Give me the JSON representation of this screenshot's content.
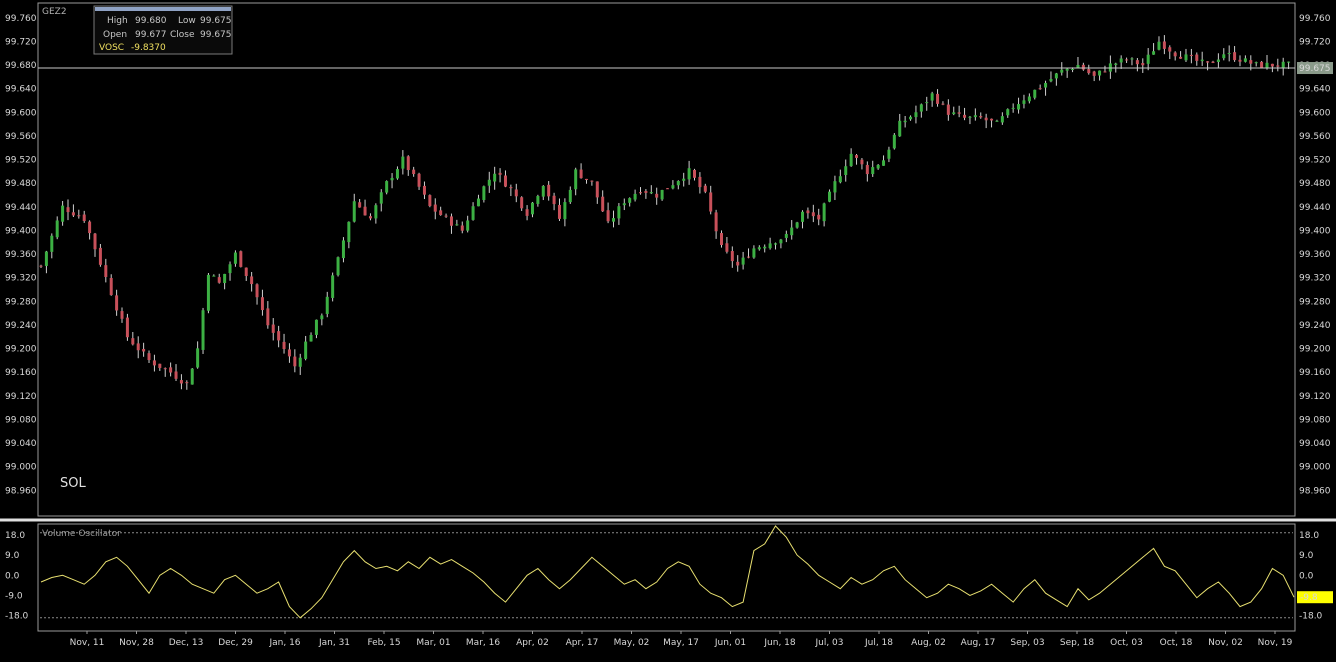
{
  "symbol": "GEZ2",
  "panel_label": "SOL",
  "infobox": {
    "high_label": "High",
    "high_value": "99.680",
    "low_label": "Low",
    "low_value": "99.675",
    "open_label": "Open",
    "open_value": "99.677",
    "close_label": "Close",
    "close_value": "99.675",
    "vosc_label": "VOSC",
    "vosc_value": "-9.8370"
  },
  "colors": {
    "background": "#000000",
    "up_candle": "#3cb043",
    "down_candle": "#c8505a",
    "wick": "#d0d0d0",
    "oscillator_line": "#e8e070",
    "price_marker": "#8a9a8a",
    "osc_marker": "#ffff00",
    "frame": "#9a9a9a",
    "splitter": "#e0e0e0"
  },
  "chart_data": [
    {
      "type": "candlestick",
      "title": "GEZ2",
      "ylim": [
        98.92,
        99.78
      ],
      "y_ticks": [
        "99.760",
        "99.720",
        "99.680",
        "99.640",
        "99.600",
        "99.560",
        "99.520",
        "99.480",
        "99.440",
        "99.400",
        "99.360",
        "99.320",
        "99.280",
        "99.240",
        "99.200",
        "99.160",
        "99.120",
        "99.080",
        "99.040",
        "99.000",
        "98.960"
      ],
      "last_price": 99.675,
      "last_price_label": "99.675",
      "x_date_labels": [
        "Nov, 11",
        "Nov, 28",
        "Dec, 13",
        "Dec, 29",
        "Jan, 16",
        "Jan, 31",
        "Feb, 15",
        "Mar, 01",
        "Mar, 16",
        "Apr, 02",
        "Apr, 17",
        "May, 02",
        "May, 17",
        "Jun, 01",
        "Jun, 18",
        "Jul, 03",
        "Jul, 18",
        "Aug, 02",
        "Aug, 17",
        "Sep, 03",
        "Sep, 18",
        "Oct, 03",
        "Oct, 18",
        "Nov, 02",
        "Nov, 19"
      ],
      "close_path": [
        [
          0,
          99.34
        ],
        [
          4,
          99.44
        ],
        [
          8,
          99.42
        ],
        [
          12,
          99.32
        ],
        [
          16,
          99.22
        ],
        [
          20,
          99.18
        ],
        [
          24,
          99.16
        ],
        [
          27,
          99.14
        ],
        [
          29,
          99.2
        ],
        [
          31,
          99.33
        ],
        [
          33,
          99.31
        ],
        [
          36,
          99.36
        ],
        [
          39,
          99.31
        ],
        [
          42,
          99.24
        ],
        [
          45,
          99.2
        ],
        [
          47,
          99.17
        ],
        [
          49,
          99.21
        ],
        [
          52,
          99.26
        ],
        [
          55,
          99.35
        ],
        [
          58,
          99.45
        ],
        [
          61,
          99.42
        ],
        [
          64,
          99.48
        ],
        [
          67,
          99.52
        ],
        [
          69,
          99.49
        ],
        [
          72,
          99.44
        ],
        [
          75,
          99.42
        ],
        [
          78,
          99.4
        ],
        [
          81,
          99.46
        ],
        [
          84,
          99.5
        ],
        [
          87,
          99.47
        ],
        [
          90,
          99.43
        ],
        [
          93,
          99.48
        ],
        [
          96,
          99.42
        ],
        [
          99,
          99.5
        ],
        [
          102,
          99.48
        ],
        [
          105,
          99.41
        ],
        [
          108,
          99.45
        ],
        [
          111,
          99.47
        ],
        [
          114,
          99.46
        ],
        [
          117,
          99.48
        ],
        [
          120,
          99.5
        ],
        [
          123,
          99.46
        ],
        [
          126,
          99.37
        ],
        [
          129,
          99.34
        ],
        [
          132,
          99.37
        ],
        [
          135,
          99.38
        ],
        [
          138,
          99.39
        ],
        [
          141,
          99.43
        ],
        [
          144,
          99.42
        ],
        [
          147,
          99.48
        ],
        [
          150,
          99.53
        ],
        [
          153,
          99.5
        ],
        [
          156,
          99.52
        ],
        [
          159,
          99.58
        ],
        [
          162,
          99.6
        ],
        [
          165,
          99.63
        ],
        [
          168,
          99.6
        ],
        [
          171,
          99.59
        ],
        [
          174,
          99.59
        ],
        [
          177,
          99.58
        ],
        [
          180,
          99.61
        ],
        [
          183,
          99.63
        ],
        [
          186,
          99.65
        ],
        [
          189,
          99.67
        ],
        [
          192,
          99.68
        ],
        [
          195,
          99.66
        ],
        [
          198,
          99.68
        ],
        [
          201,
          99.69
        ],
        [
          204,
          99.68
        ],
        [
          207,
          99.72
        ],
        [
          210,
          99.7
        ],
        [
          213,
          99.69
        ],
        [
          216,
          99.68
        ],
        [
          219,
          99.7
        ],
        [
          222,
          99.69
        ],
        [
          225,
          99.68
        ]
      ],
      "oscillator": {
        "name": "Volume Oscillator",
        "ylim": [
          -24,
          22
        ],
        "y_ticks": [
          "18.0",
          "9.0",
          "0.0",
          "-9.0",
          "-18.0"
        ],
        "reference_lines": [
          19,
          -19
        ],
        "last_value_label": "-9.8",
        "values": [
          [
            0,
            -3
          ],
          [
            2,
            -1
          ],
          [
            4,
            0
          ],
          [
            6,
            -2
          ],
          [
            8,
            -4
          ],
          [
            10,
            0
          ],
          [
            12,
            6
          ],
          [
            14,
            8
          ],
          [
            16,
            4
          ],
          [
            18,
            -2
          ],
          [
            20,
            -8
          ],
          [
            22,
            0
          ],
          [
            24,
            3
          ],
          [
            26,
            0
          ],
          [
            28,
            -4
          ],
          [
            30,
            -6
          ],
          [
            32,
            -8
          ],
          [
            34,
            -2
          ],
          [
            36,
            0
          ],
          [
            38,
            -4
          ],
          [
            40,
            -8
          ],
          [
            42,
            -6
          ],
          [
            44,
            -3
          ],
          [
            46,
            -14
          ],
          [
            48,
            -19
          ],
          [
            50,
            -15
          ],
          [
            52,
            -10
          ],
          [
            54,
            -2
          ],
          [
            56,
            6
          ],
          [
            58,
            11
          ],
          [
            60,
            6
          ],
          [
            62,
            3
          ],
          [
            64,
            4
          ],
          [
            66,
            2
          ],
          [
            68,
            6
          ],
          [
            70,
            3
          ],
          [
            72,
            8
          ],
          [
            74,
            5
          ],
          [
            76,
            7
          ],
          [
            78,
            4
          ],
          [
            80,
            1
          ],
          [
            82,
            -3
          ],
          [
            84,
            -8
          ],
          [
            86,
            -12
          ],
          [
            88,
            -6
          ],
          [
            90,
            0
          ],
          [
            92,
            3
          ],
          [
            94,
            -2
          ],
          [
            96,
            -6
          ],
          [
            98,
            -2
          ],
          [
            100,
            3
          ],
          [
            102,
            8
          ],
          [
            104,
            4
          ],
          [
            106,
            0
          ],
          [
            108,
            -4
          ],
          [
            110,
            -2
          ],
          [
            112,
            -6
          ],
          [
            114,
            -3
          ],
          [
            116,
            3
          ],
          [
            118,
            6
          ],
          [
            120,
            4
          ],
          [
            122,
            -4
          ],
          [
            124,
            -8
          ],
          [
            126,
            -10
          ],
          [
            128,
            -14
          ],
          [
            130,
            -12
          ],
          [
            132,
            11
          ],
          [
            134,
            14
          ],
          [
            136,
            22
          ],
          [
            138,
            17
          ],
          [
            140,
            9
          ],
          [
            142,
            5
          ],
          [
            144,
            0
          ],
          [
            146,
            -3
          ],
          [
            148,
            -6
          ],
          [
            150,
            -1
          ],
          [
            152,
            -4
          ],
          [
            154,
            -2
          ],
          [
            156,
            2
          ],
          [
            158,
            4
          ],
          [
            160,
            -2
          ],
          [
            162,
            -6
          ],
          [
            164,
            -10
          ],
          [
            166,
            -8
          ],
          [
            168,
            -4
          ],
          [
            170,
            -6
          ],
          [
            172,
            -9
          ],
          [
            174,
            -7
          ],
          [
            176,
            -4
          ],
          [
            178,
            -8
          ],
          [
            180,
            -12
          ],
          [
            182,
            -6
          ],
          [
            184,
            -2
          ],
          [
            186,
            -8
          ],
          [
            188,
            -11
          ],
          [
            190,
            -14
          ],
          [
            192,
            -6
          ],
          [
            194,
            -11
          ],
          [
            196,
            -8
          ],
          [
            198,
            -4
          ],
          [
            200,
            0
          ],
          [
            202,
            4
          ],
          [
            204,
            8
          ],
          [
            206,
            12
          ],
          [
            208,
            4
          ],
          [
            210,
            2
          ],
          [
            212,
            -4
          ],
          [
            214,
            -10
          ],
          [
            216,
            -6
          ],
          [
            218,
            -3
          ],
          [
            220,
            -8
          ],
          [
            222,
            -14
          ],
          [
            224,
            -12
          ],
          [
            226,
            -6
          ],
          [
            228,
            3
          ],
          [
            230,
            0
          ],
          [
            232,
            -9.8
          ]
        ]
      }
    }
  ]
}
